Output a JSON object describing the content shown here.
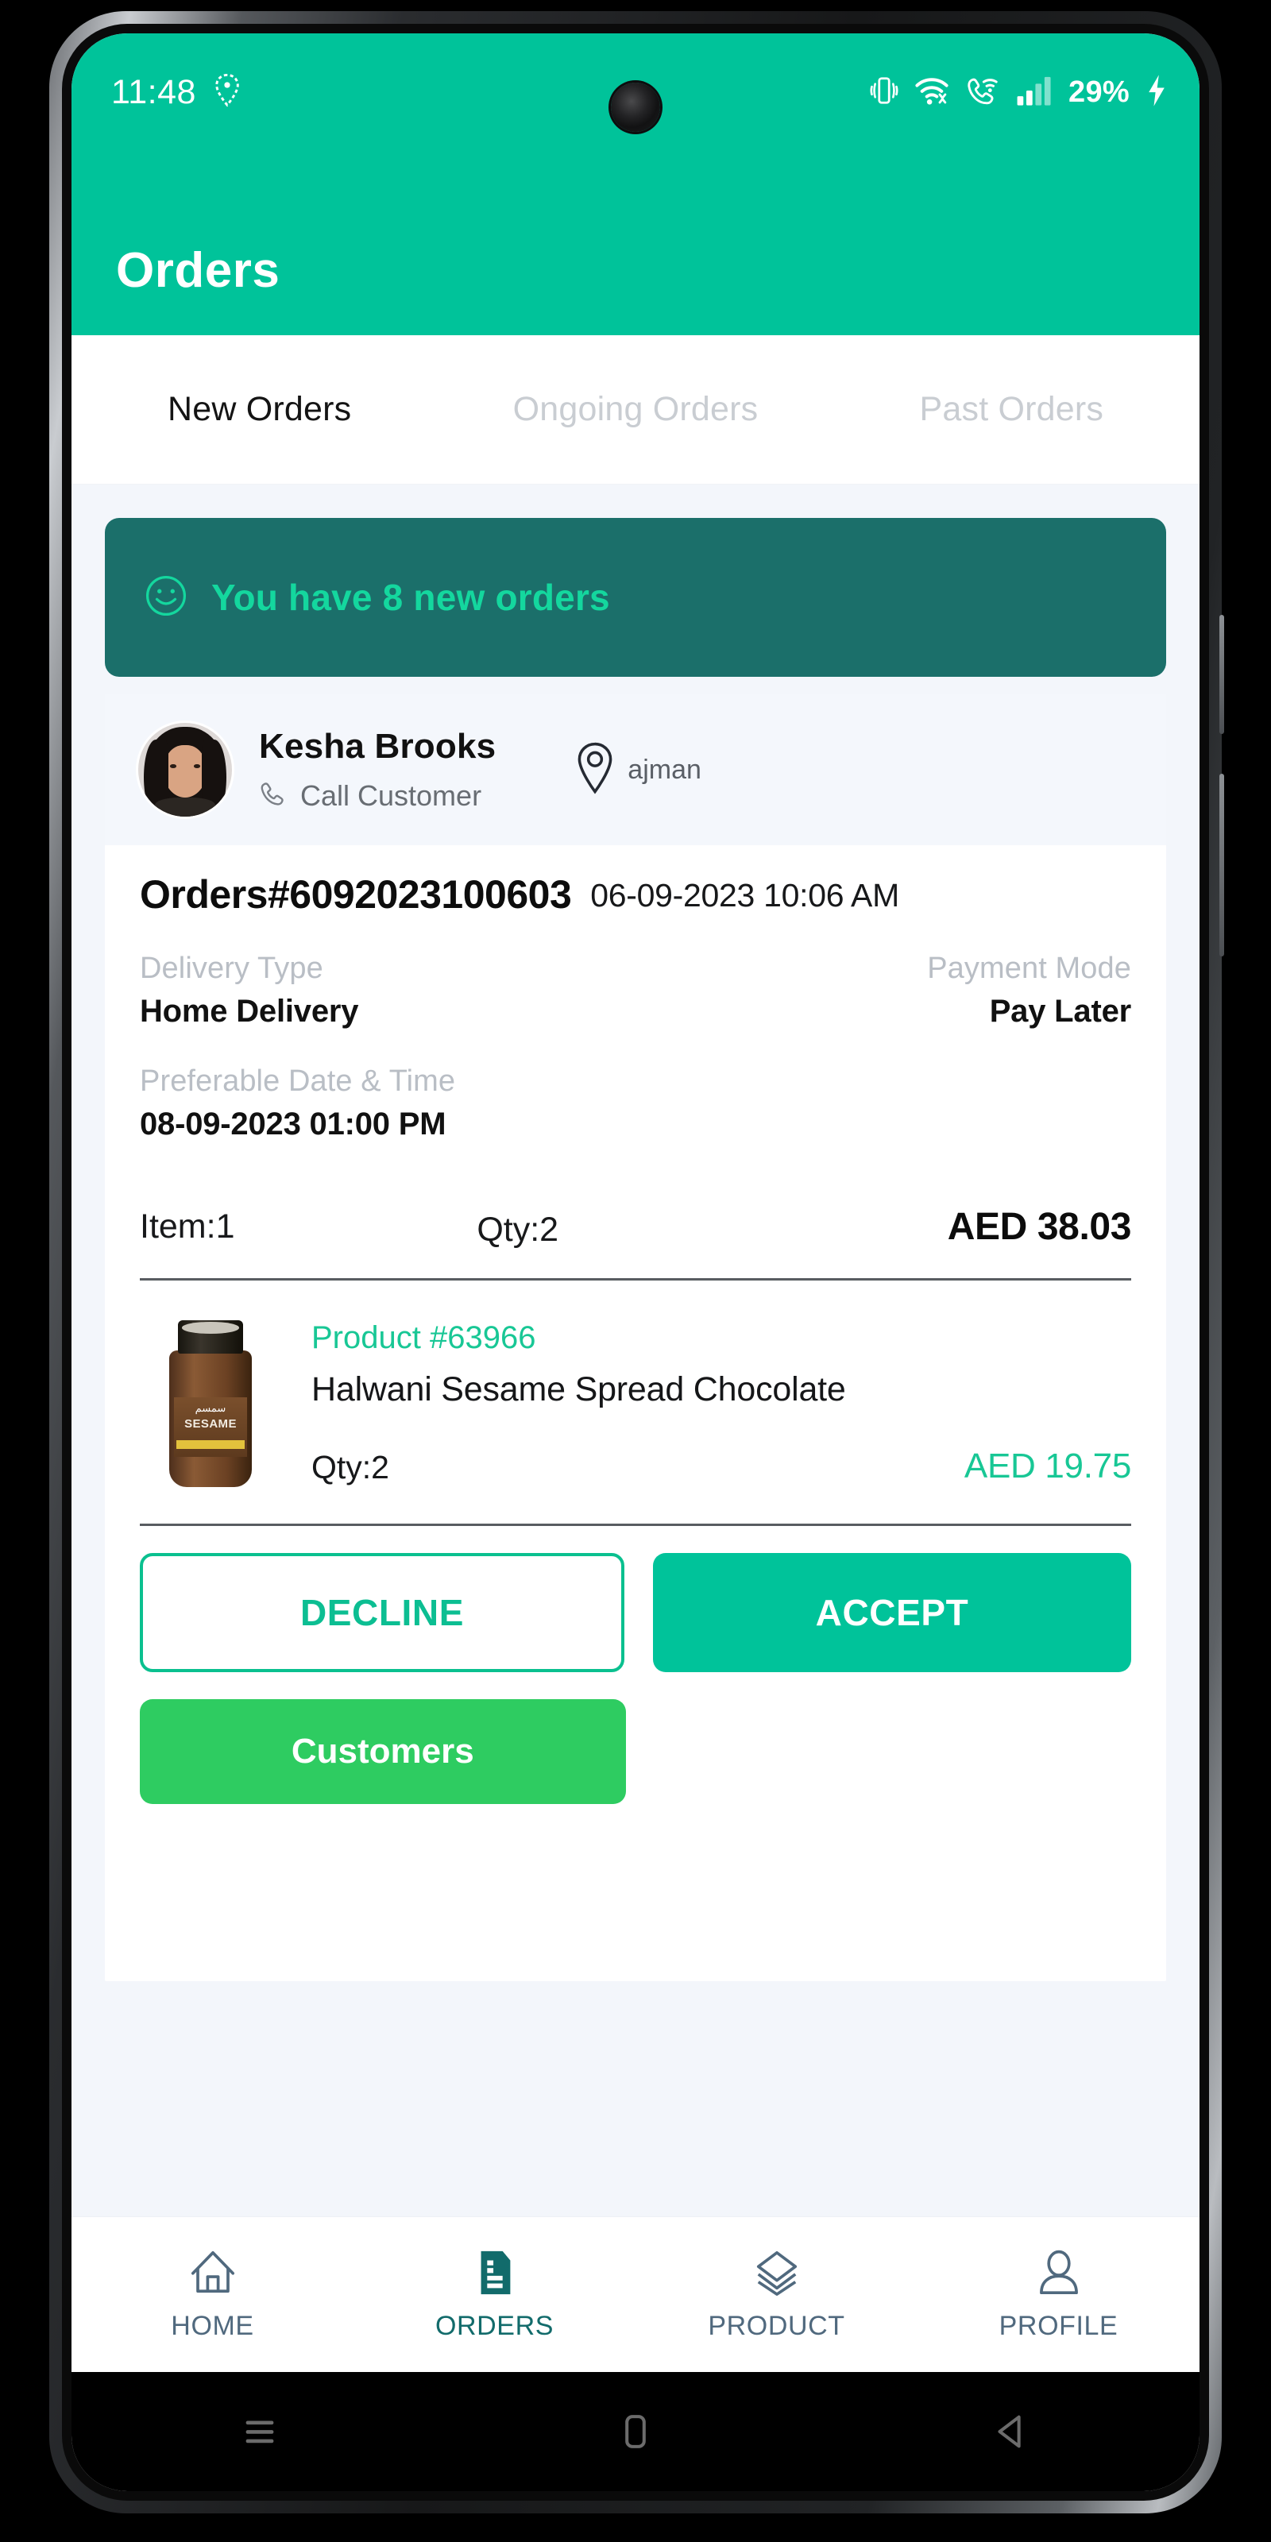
{
  "status_bar": {
    "time": "11:48",
    "battery_percent": "29%",
    "icons": [
      "location-icon",
      "vibrate-icon",
      "wifi-icon",
      "wifi-calling-icon",
      "signal-bars-icon",
      "battery-charging-icon"
    ]
  },
  "app_bar": {
    "title": "Orders"
  },
  "tabs": [
    {
      "label": "New Orders",
      "active": true
    },
    {
      "label": "Ongoing Orders",
      "active": false
    },
    {
      "label": "Past Orders",
      "active": false
    }
  ],
  "banner": {
    "text": "You have 8 new orders",
    "icon": "smiley-icon"
  },
  "order": {
    "customer": {
      "name": "Kesha  Brooks",
      "call_label": "Call Customer",
      "location": "ajman"
    },
    "number": "Orders#6092023100603",
    "datetime": "06-09-2023 10:06 AM",
    "delivery_type_label": "Delivery Type",
    "delivery_type_value": "Home Delivery",
    "payment_mode_label": "Payment Mode",
    "payment_mode_value": "Pay Later",
    "preferable_label": "Preferable Date & Time",
    "preferable_value": "08-09-2023 01:00 PM",
    "items_summary": "Item:1",
    "qty_summary": "Qty:2",
    "total_amount": "AED 38.03",
    "products": [
      {
        "id": "Product #63966",
        "name": "Halwani Sesame Spread Chocolate",
        "qty": "Qty:2",
        "price": "AED 19.75",
        "thumb_label": "SESAME",
        "thumb_label_ar": "سمسم"
      }
    ]
  },
  "actions": {
    "decline": "DECLINE",
    "accept": "ACCEPT",
    "customers": "Customers"
  },
  "bottom_nav": [
    {
      "label": "HOME",
      "icon": "home-icon",
      "active": false
    },
    {
      "label": "ORDERS",
      "icon": "document-icon",
      "active": true
    },
    {
      "label": "PRODUCT",
      "icon": "layers-icon",
      "active": false
    },
    {
      "label": "PROFILE",
      "icon": "person-icon",
      "active": false
    }
  ],
  "system_bar": [
    "recents-icon",
    "home-icon",
    "back-icon"
  ],
  "colors": {
    "primary": "#00c39a",
    "banner_bg": "#1b6f6a",
    "banner_text": "#14d79e",
    "accent_green": "#18c795",
    "customers_green": "#2ecc61",
    "nav_inactive": "#50697e",
    "nav_active": "#126b6b"
  }
}
